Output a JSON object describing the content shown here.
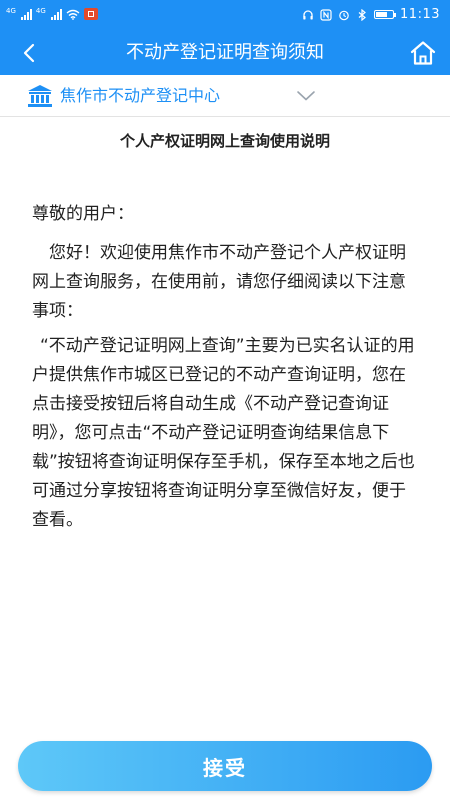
{
  "status_bar": {
    "network_1": "4G",
    "network_2": "4G",
    "time": "11:13",
    "battery_level": 0.7,
    "icons": [
      "headset-icon",
      "nfc-icon",
      "alarm-icon",
      "bluetooth-icon",
      "battery-icon"
    ]
  },
  "header": {
    "title": "不动产登记证明查询须知",
    "back_icon": "back-arrow-icon",
    "home_icon": "home-icon",
    "background_color": "#1e90f5"
  },
  "selector": {
    "center_name": "焦作市不动产登记中心",
    "icon": "building-icon",
    "dropdown_icon": "chevron-down-icon",
    "accent_color": "#1e90f5"
  },
  "document": {
    "title": "个人产权证明网上查询使用说明",
    "greeting": "尊敬的用户：",
    "paragraph_1": "您好！欢迎使用焦作市不动产登记个人产权证明网上查询服务，在使用前，请您仔细阅读以下注意事项：",
    "paragraph_2": "“不动产登记证明网上查询”主要为已实名认证的用户提供焦作市城区已登记的不动产查询证明，您在点击接受按钮后将自动生成《不动产登记查询证明》，您可点击“不动产登记证明查询结果信息下载”按钮将查询证明保存至手机，保存至本地之后也可通过分享按钮将查询证明分享至微信好友，便于查看。"
  },
  "footer": {
    "accept_label": "接受"
  }
}
